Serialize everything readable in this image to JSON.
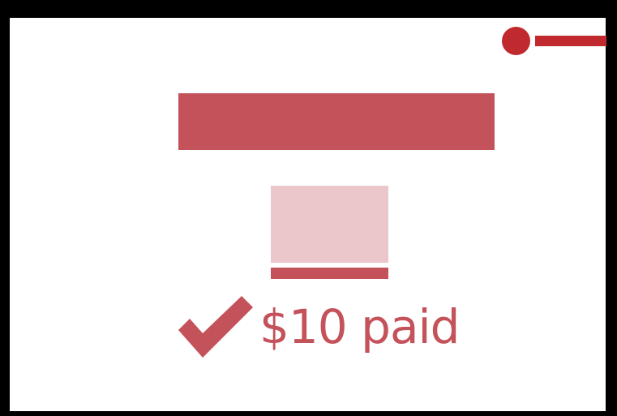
{
  "payment": {
    "status_text": "$10 paid"
  },
  "icons": {
    "status_indicator": "toggle-indicator-icon",
    "paid_check": "checkmark-icon"
  },
  "colors": {
    "frame": "#000000",
    "accent": "#c0292d",
    "primary": "#c4525a",
    "primary_light": "#ebc6cb",
    "background": "#ffffff"
  }
}
